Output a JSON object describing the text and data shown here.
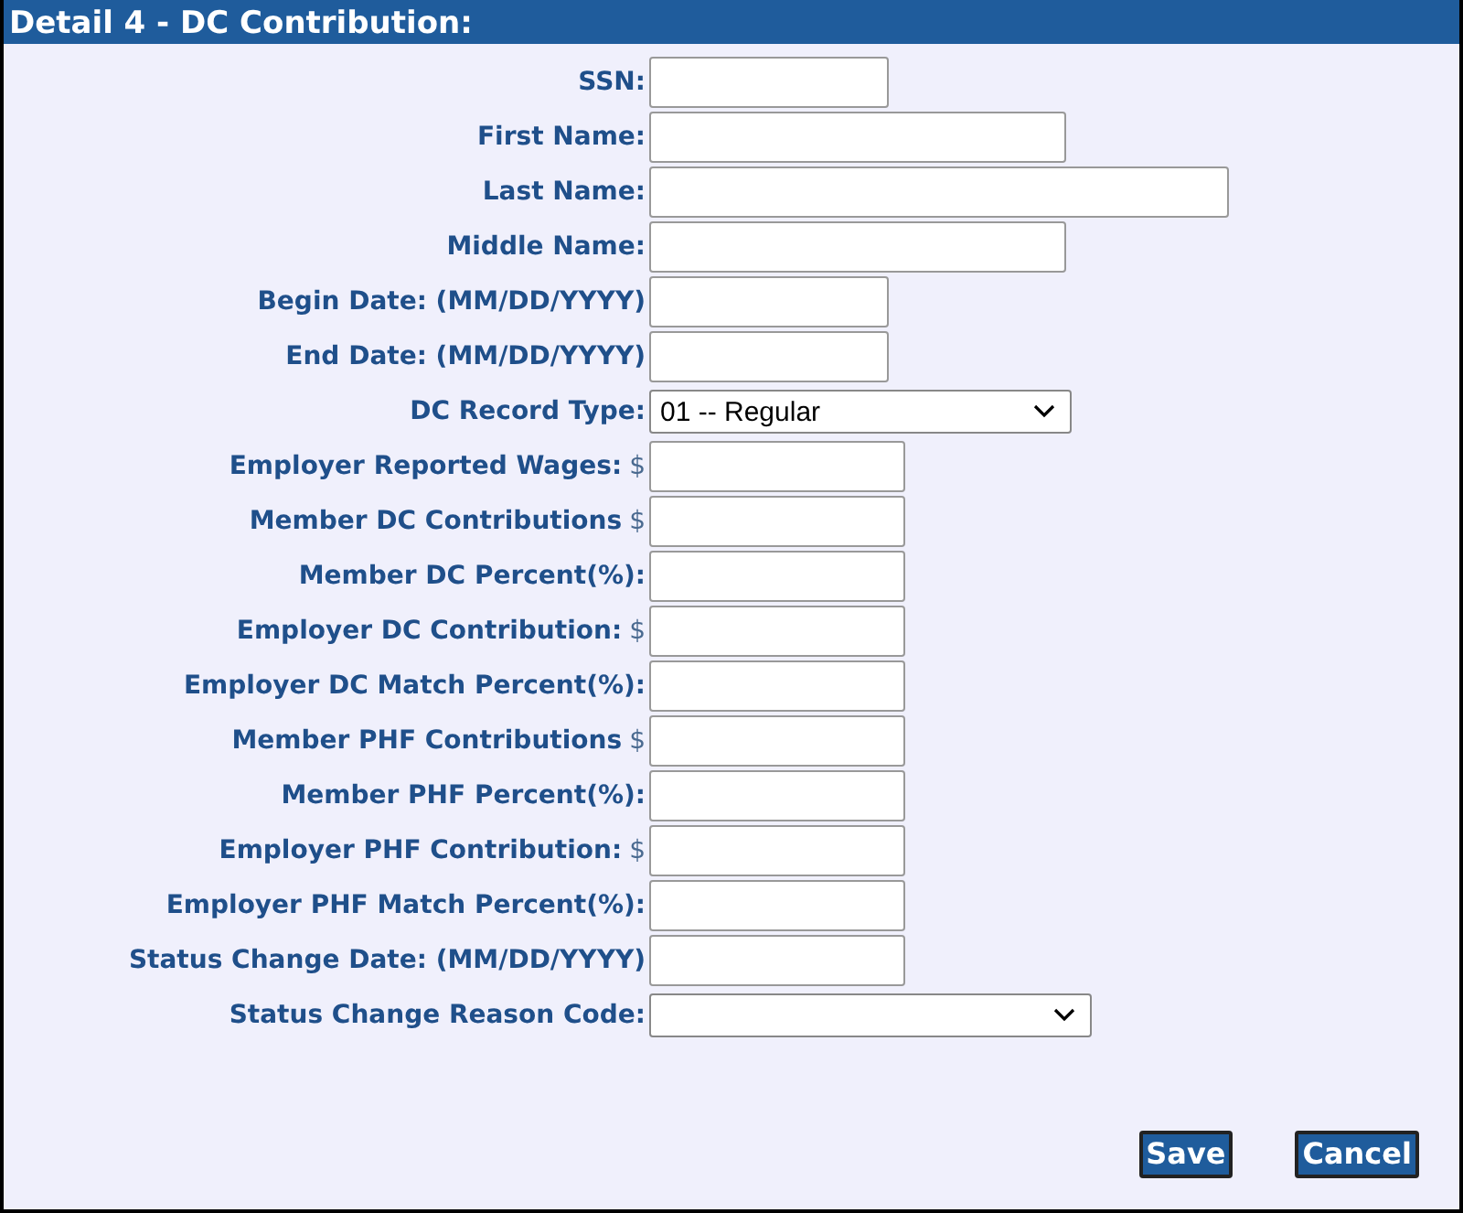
{
  "window": {
    "title": "Detail 4 - DC Contribution:"
  },
  "fields": [
    {
      "label": "SSN:",
      "kind": "text"
    },
    {
      "label": "First Name:",
      "kind": "text"
    },
    {
      "label": "Last Name:",
      "kind": "text"
    },
    {
      "label": "Middle Name:",
      "kind": "text"
    },
    {
      "label": "Begin Date: (MM/DD/YYYY)",
      "kind": "text"
    },
    {
      "label": "End Date: (MM/DD/YYYY)",
      "kind": "text"
    },
    {
      "label": "DC Record Type:",
      "kind": "select",
      "value": "01 -- Regular"
    },
    {
      "label": "Employer Reported Wages:",
      "prefix": "$",
      "kind": "text"
    },
    {
      "label": "Member DC Contributions",
      "prefix": "$",
      "kind": "text"
    },
    {
      "label": "Member DC Percent(%):",
      "kind": "text"
    },
    {
      "label": "Employer DC Contribution:",
      "prefix": "$",
      "kind": "text"
    },
    {
      "label": "Employer DC Match Percent(%):",
      "kind": "text"
    },
    {
      "label": "Member PHF Contributions",
      "prefix": "$",
      "kind": "text"
    },
    {
      "label": "Member PHF Percent(%):",
      "kind": "text"
    },
    {
      "label": "Employer PHF Contribution:",
      "prefix": "$",
      "kind": "text"
    },
    {
      "label": "Employer PHF Match Percent(%):",
      "kind": "text"
    },
    {
      "label": "Status Change Date: (MM/DD/YYYY)",
      "kind": "text"
    },
    {
      "label": "Status Change Reason Code:",
      "kind": "select"
    }
  ],
  "buttons": [
    "Save",
    "Cancel"
  ]
}
